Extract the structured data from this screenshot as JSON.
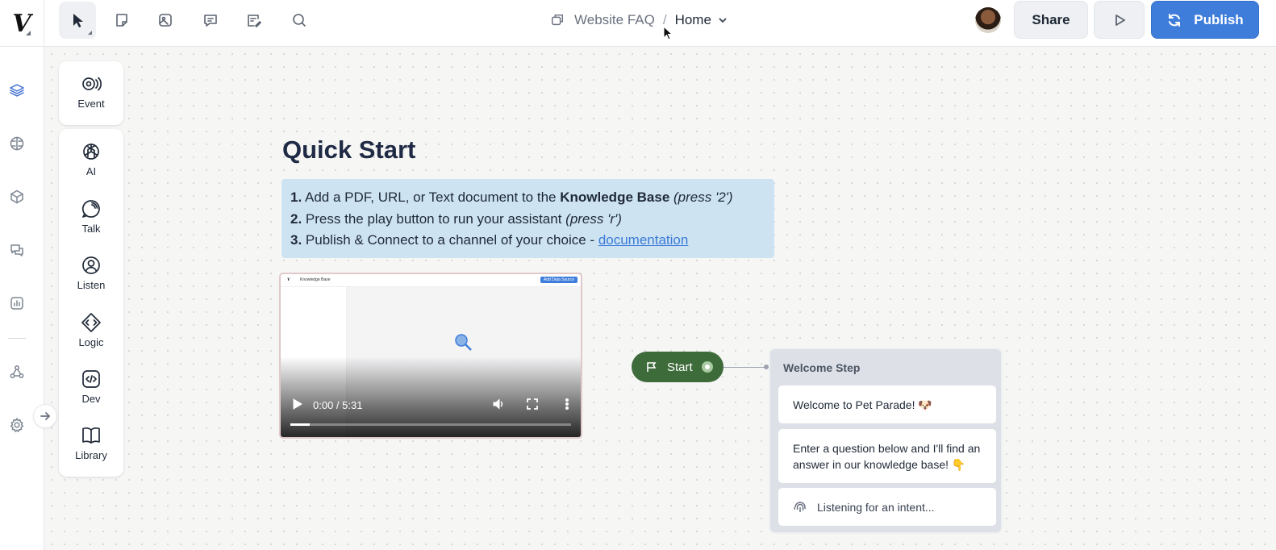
{
  "brand": {
    "logo_text": "V"
  },
  "toolbar": {
    "tools": [
      "select-tool",
      "note-tool",
      "image-tool",
      "comment-tool",
      "notes-list-tool",
      "search-tool"
    ]
  },
  "breadcrumb": {
    "project": "Website FAQ",
    "separator": "/",
    "page": "Home"
  },
  "header": {
    "share_label": "Share",
    "publish_label": "Publish"
  },
  "rail": {
    "items": [
      "layers",
      "knowledge-base",
      "components",
      "conversations",
      "analytics",
      "integrations",
      "settings"
    ]
  },
  "palette": {
    "event": {
      "label": "Event"
    },
    "items": [
      {
        "label": "AI"
      },
      {
        "label": "Talk"
      },
      {
        "label": "Listen"
      },
      {
        "label": "Logic"
      },
      {
        "label": "Dev"
      },
      {
        "label": "Library"
      }
    ]
  },
  "quickstart": {
    "title": "Quick Start",
    "steps": [
      {
        "num": "1.",
        "text": "Add a PDF, URL, or Text document to the ",
        "bold": "Knowledge Base",
        "italic": " (press '2')"
      },
      {
        "num": "2.",
        "text": "Press the play button to run your assistant ",
        "italic": "(press 'r')"
      },
      {
        "num": "3.",
        "text": "Publish & Connect to a channel of your choice - ",
        "link": "documentation"
      }
    ]
  },
  "video": {
    "time": "0:00 / 5:31",
    "progress": 0.07,
    "thumb_title": "Knowledge Base",
    "thumb_button": "Add Data Source"
  },
  "flow": {
    "start_label": "Start",
    "welcome": {
      "title": "Welcome Step",
      "messages": [
        "Welcome to Pet Parade! 🐶",
        "Enter a question below and I'll find an answer in our knowledge base! 👇"
      ],
      "listening": "Listening for an intent..."
    }
  },
  "colors": {
    "accent": "#3f7ddb",
    "start_node": "#3e6b3a",
    "quickstart_bg": "#cde3f2"
  }
}
